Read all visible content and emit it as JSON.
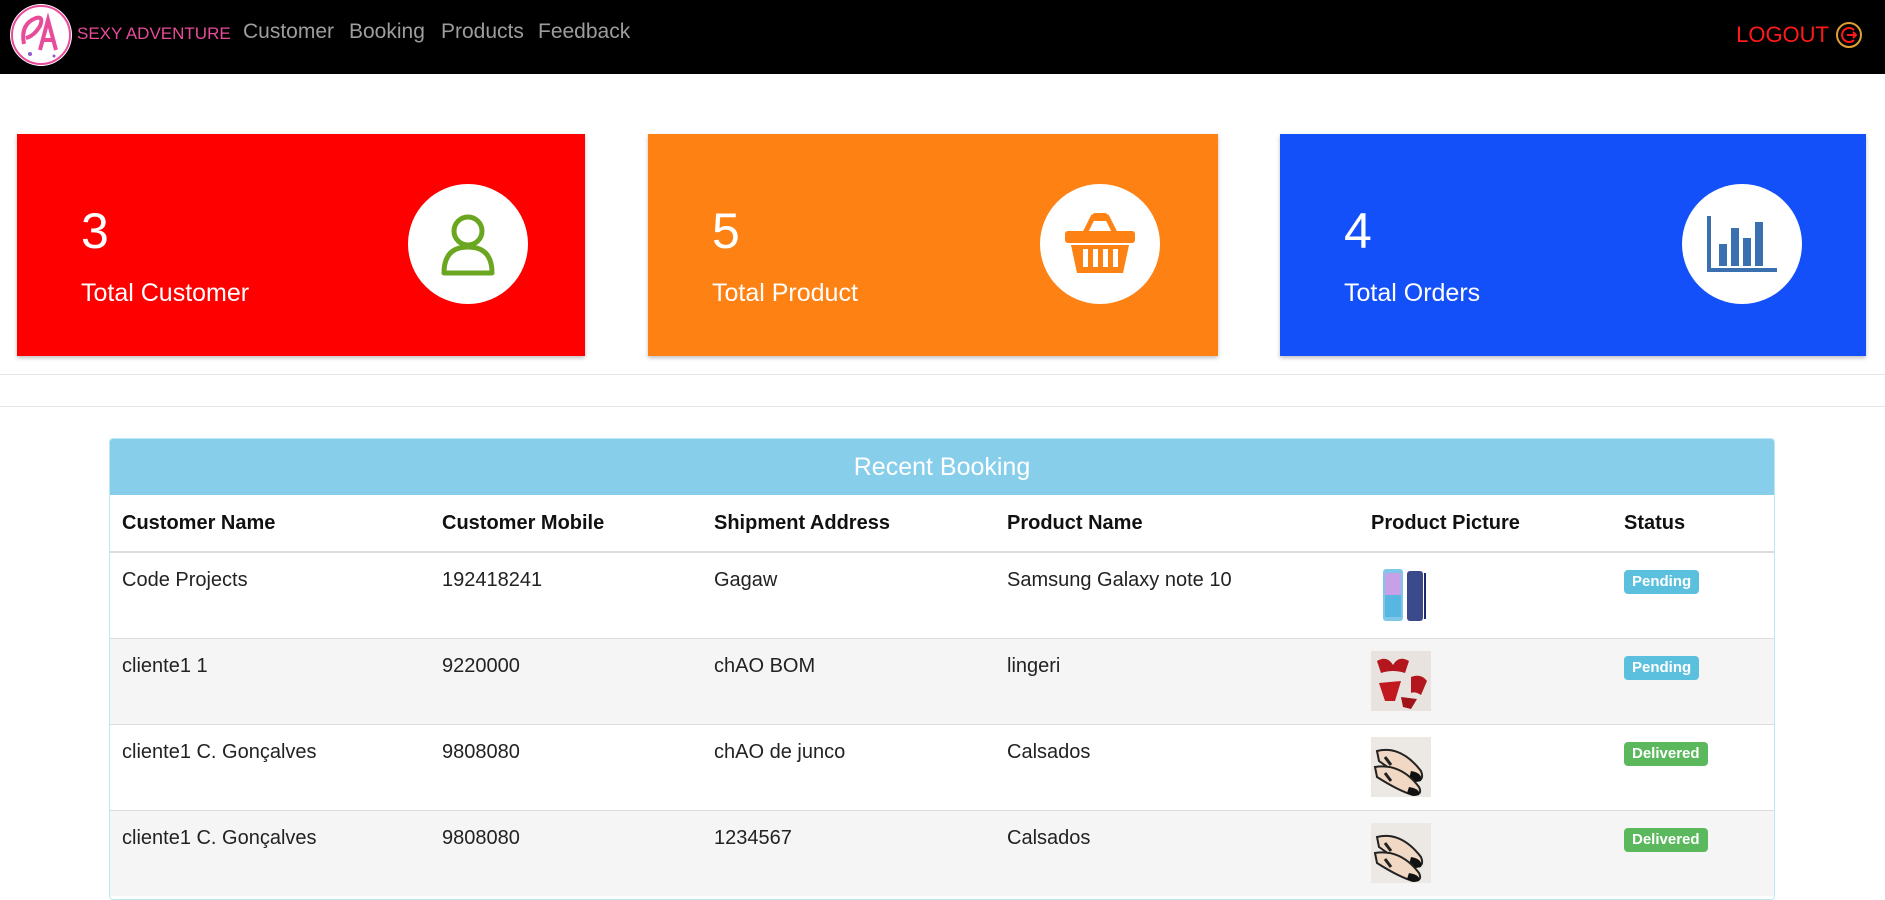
{
  "brand": {
    "name": "SEXY ADVENTURE"
  },
  "nav": {
    "links": [
      "Customer",
      "Booking",
      "Products",
      "Feedback"
    ],
    "logout": "LOGOUT"
  },
  "stats": [
    {
      "value": "3",
      "label": "Total Customer",
      "color": "#ff0000",
      "icon": "user-icon",
      "icon_color": "#6aa620"
    },
    {
      "value": "5",
      "label": "Total Product",
      "color": "#fd8213",
      "icon": "basket-icon",
      "icon_color": "#fd8213"
    },
    {
      "value": "4",
      "label": "Total Orders",
      "color": "#1450fa",
      "icon": "bar-chart-icon",
      "icon_color": "#3a6fb0"
    }
  ],
  "booking": {
    "title": "Recent Booking",
    "columns": [
      "Customer Name",
      "Customer Mobile",
      "Shipment Address",
      "Product Name",
      "Product Picture",
      "Status"
    ],
    "rows": [
      {
        "name": "Code Projects",
        "mobile": "192418241",
        "address": "Gagaw",
        "product": "Samsung Galaxy note 10",
        "picture": "phone-image",
        "status": "Pending"
      },
      {
        "name": "cliente1 1",
        "mobile": "9220000",
        "address": "chAO BOM",
        "product": "lingeri",
        "picture": "lingerie-image",
        "status": "Pending"
      },
      {
        "name": "cliente1 C. Gonçalves",
        "mobile": "9808080",
        "address": "chAO de junco",
        "product": "Calsados",
        "picture": "shoes-image",
        "status": "Delivered"
      },
      {
        "name": "cliente1 C. Gonçalves",
        "mobile": "9808080",
        "address": "1234567",
        "product": "Calsados",
        "picture": "shoes-image",
        "status": "Delivered"
      }
    ]
  },
  "colors": {
    "pending": "#5bc0de",
    "delivered": "#5cb85c",
    "logout": "#ff1a1a",
    "brand": "#e84b9a"
  }
}
